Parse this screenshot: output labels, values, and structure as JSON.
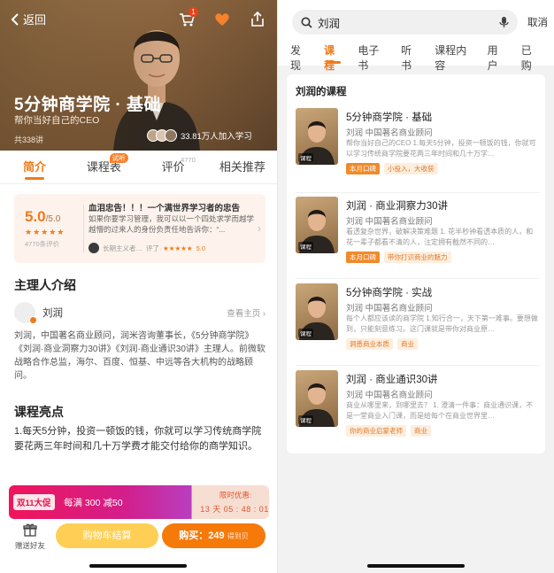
{
  "left": {
    "back_label": "返回",
    "cart_badge": "1",
    "hero": {
      "title": "5分钟商学院 · 基础",
      "subtitle": "帮你当好自己的CEO",
      "lesson_count": "共338讲",
      "join_text": "33.81万人加入学习"
    },
    "tabs": [
      {
        "label": "简介",
        "active": true
      },
      {
        "label": "课程表",
        "tag": "试听"
      },
      {
        "label": "评价",
        "count": "4770"
      },
      {
        "label": "相关推荐"
      }
    ],
    "review": {
      "score": "5.0",
      "score_max": "/5.0",
      "stars": "★★★★★",
      "count_text": "4770条评价",
      "title": "血泪忠告！！！一个满世界学习者的忠告",
      "body": "如果你要学习管理，我可以以一个四处求学而越学越懵的过来人的身份负责任地告诉你：“...",
      "user": "长期主义者…",
      "rated": "评了",
      "user_stars": "★★★★★",
      "user_score": "5.0"
    },
    "host_section_title": "主理人介绍",
    "host": {
      "name": "刘润",
      "link": "查看主页 ›",
      "bio": "刘润，中国著名商业顾问，润米咨询董事长，《5分钟商学院》《刘润·商业洞察力30讲》《刘润·商业通识30讲》主理人。前微软战略合作总监，海尔、百度、恒基、中远等各大机构的战略顾问。"
    },
    "highlight_section_title": "课程亮点",
    "highlight_text": "1.每天5分钟，投资一顿饭的钱，你就可以学习传统商学院要花两三年时间和几十万学费才能交付给你的商学知识。",
    "promo": {
      "badge": "双11大促",
      "text": "每满 300 减50",
      "limit_label": "限时优惠:",
      "timer": "13 天 05 : 48 : 01"
    },
    "bottom": {
      "gift_label": "赠送好友",
      "cart_button": "购物车结算",
      "buy_button": "购买：249",
      "buy_unit": "得到贝"
    }
  },
  "right": {
    "search_query": "刘润",
    "cancel_label": "取消",
    "tabs": [
      {
        "label": "发现"
      },
      {
        "label": "课程",
        "active": true
      },
      {
        "label": "电子书"
      },
      {
        "label": "听书"
      },
      {
        "label": "课程内容"
      },
      {
        "label": "用户"
      },
      {
        "label": "已购"
      }
    ],
    "section_title": "刘润的课程",
    "courses": [
      {
        "title": "5分钟商学院 · 基础",
        "author": "刘润 中国著名商业顾问",
        "desc": "帮你当好自己的CEO 1.每天5分钟，投资一顿饭的钱，你就可以学习传统商学院要花两三年时间和几十万学…",
        "tags": [
          "本月口碑",
          "小投入，大收获"
        ],
        "thumb_label": "课程"
      },
      {
        "title": "刘润 · 商业洞察力30讲",
        "author": "刘润 中国著名商业顾问",
        "desc": "看透复杂世界，破解决策难题 1. 花半秒钟看透本质的人，和花一辈子都看不清的人，注定拥有截然不同的…",
        "tags": [
          "本月口碑",
          "带你打识商业的魅力"
        ],
        "thumb_label": "课程"
      },
      {
        "title": "5分钟商学院 · 实战",
        "author": "刘润 中国著名商业顾问",
        "desc": "每个人都应该读的商学院 1.知行合一，天下第一难事。要想做到，只能刻意练习。这门课就是带你对商业原…",
        "tags": [
          "洞悉商业本质",
          "商业"
        ],
        "thumb_label": "课程"
      },
      {
        "title": "刘润 · 商业通识30讲",
        "author": "刘润 中国著名商业顾问",
        "desc": "商业从哪里来，到哪里去？ 1. 澄清一件事：商业通识课，不是一堂商业入门课，而是给每个在商业世界里…",
        "tags": [
          "你的商业启蒙老师",
          "商业"
        ],
        "thumb_label": "课程"
      }
    ]
  }
}
